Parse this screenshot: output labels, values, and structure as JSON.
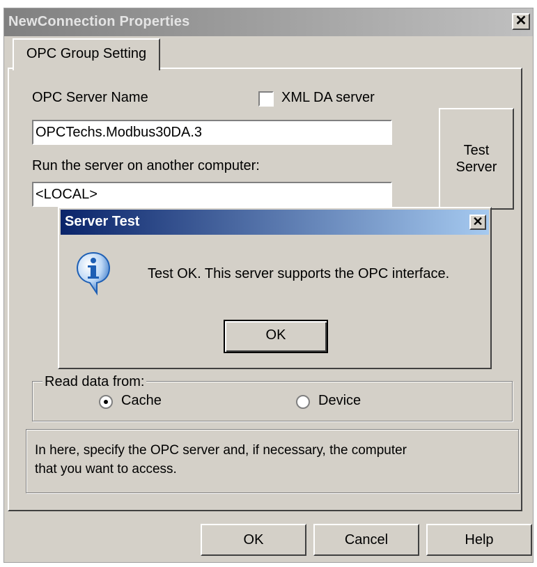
{
  "window": {
    "title": "NewConnection Properties",
    "close_glyph": "✕"
  },
  "tab": {
    "label": "OPC Group Setting"
  },
  "server_name": {
    "label": "OPC Server Name",
    "value": "OPCTechs.Modbus30DA.3"
  },
  "xml_da": {
    "label": "XML DA server",
    "checked": false
  },
  "remote": {
    "label": "Run the server on another computer:",
    "value": "<LOCAL>"
  },
  "test_server_button": {
    "line1": "Test",
    "line2": "Server"
  },
  "read_data": {
    "legend": "Read data from:",
    "options": [
      {
        "label": "Cache",
        "selected": true
      },
      {
        "label": "Device",
        "selected": false
      }
    ]
  },
  "help_text": {
    "line1": "In here, specify the OPC server and, if necessary, the computer",
    "line2": "that you want to access."
  },
  "footer": {
    "ok": "OK",
    "cancel": "Cancel",
    "help": "Help"
  },
  "dialog": {
    "title": "Server Test",
    "close_glyph": "✕",
    "icon": "info-icon",
    "message": "Test OK. This server supports the OPC interface.",
    "ok": "OK"
  },
  "colors": {
    "face": "#d4d0c8",
    "dialog_title_start": "#0a246a",
    "dialog_title_end": "#a6caf0",
    "info_icon": "#1e5fb4"
  }
}
